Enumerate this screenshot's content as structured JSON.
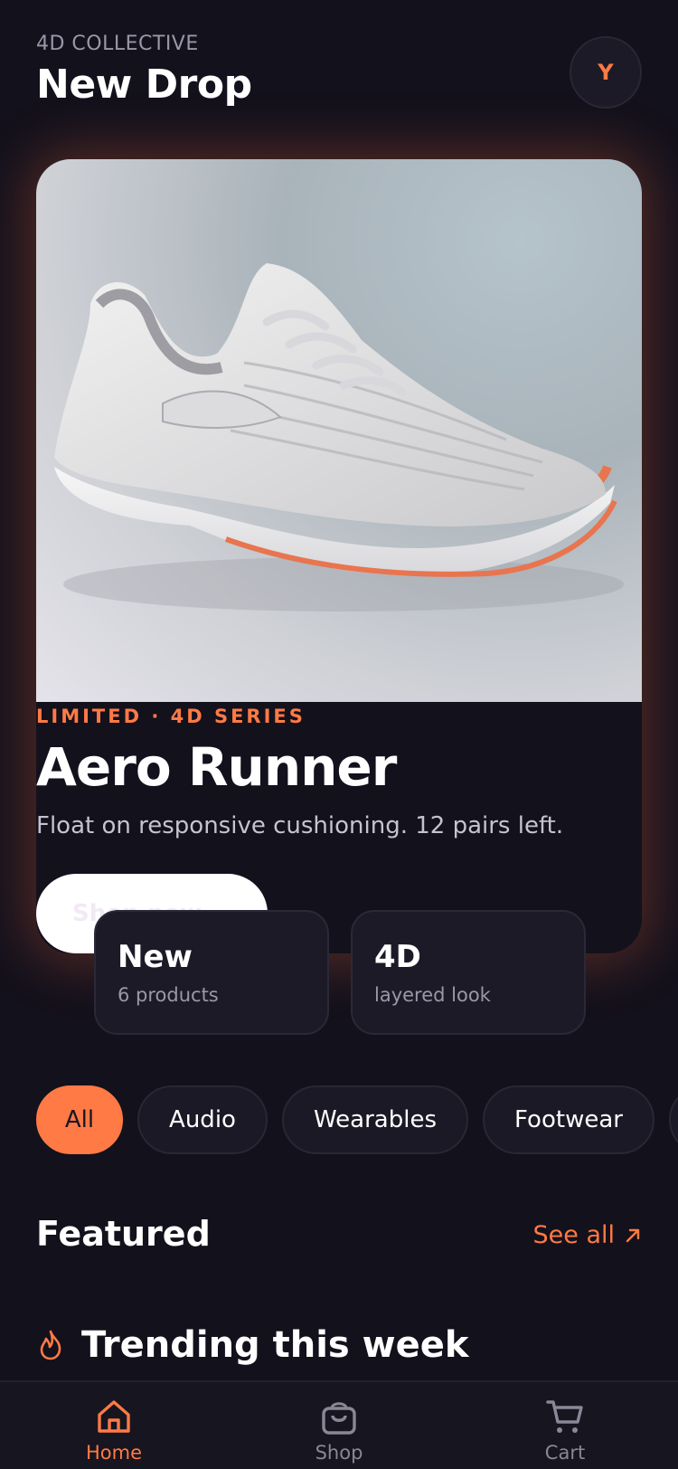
{
  "header": {
    "brand": "4D COLLECTIVE",
    "title": "New Drop",
    "avatar_initial": "Y"
  },
  "hero": {
    "eyebrow": "LIMITED · 4D SERIES",
    "title": "Aero Runner",
    "description": "Float on responsive cushioning. 12 pairs left.",
    "button_label": "Shop now"
  },
  "stats": [
    {
      "value": "New",
      "label": "6 products"
    },
    {
      "value": "4D",
      "label": "layered look"
    }
  ],
  "categories": {
    "selected": "All",
    "items": [
      "All",
      "Audio",
      "Wearables",
      "Footwear"
    ]
  },
  "featured": {
    "title": "Featured",
    "see_all": "See all"
  },
  "trending": {
    "title": "Trending this week",
    "icon": "flame-icon"
  },
  "nav": {
    "items": [
      {
        "label": "Home",
        "icon": "home-icon",
        "active": true
      },
      {
        "label": "Shop",
        "icon": "bag-icon",
        "active": false
      },
      {
        "label": "Cart",
        "icon": "cart-icon",
        "active": false
      }
    ]
  },
  "colors": {
    "background": "#13111c",
    "accent": "#ff7a45",
    "card": "#1d1a28"
  }
}
